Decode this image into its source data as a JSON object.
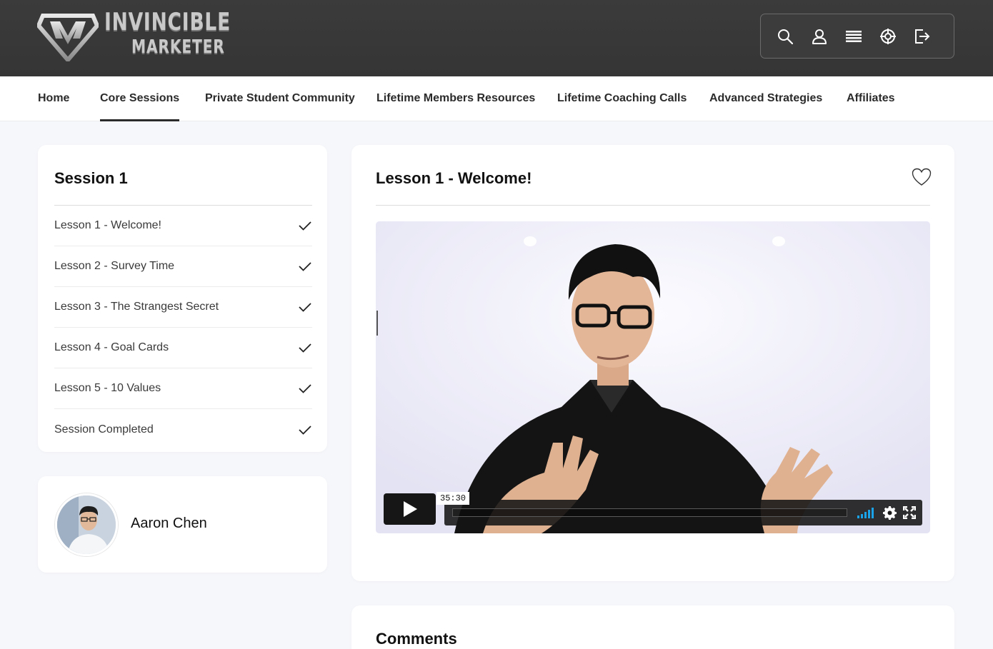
{
  "brand": {
    "line1": "INVINCIBLE",
    "line2": "MARKETER"
  },
  "toolbar": {
    "icons": [
      "search-icon",
      "user-icon",
      "list-icon",
      "support-icon",
      "logout-icon"
    ]
  },
  "nav": {
    "items": [
      {
        "label": "Home"
      },
      {
        "label": "Core Sessions",
        "active": true
      },
      {
        "label": "Private Student Community"
      },
      {
        "label": "Lifetime Members Resources"
      },
      {
        "label": "Lifetime Coaching Calls"
      },
      {
        "label": "Advanced Strategies"
      },
      {
        "label": "Affiliates"
      }
    ]
  },
  "session": {
    "title": "Session 1",
    "lessons": [
      {
        "label": "Lesson 1 - Welcome!",
        "completed": true
      },
      {
        "label": "Lesson 2 - Survey Time",
        "completed": true
      },
      {
        "label": "Lesson 3 - The Strangest Secret",
        "completed": true
      },
      {
        "label": "Lesson 4 - Goal Cards",
        "completed": true
      },
      {
        "label": "Lesson 5 - 10 Values",
        "completed": true
      },
      {
        "label": "Session Completed",
        "completed": true
      }
    ]
  },
  "author": {
    "name": "Aaron Chen"
  },
  "lesson": {
    "title": "Lesson 1 - Welcome!"
  },
  "video": {
    "duration": "35:30",
    "progress": 0
  },
  "comments": {
    "title": "Comments"
  },
  "colors": {
    "header_bg": "#3b3b3b",
    "page_bg": "#f6f7fb",
    "card_bg": "#ffffff",
    "volume_accent": "#1aa3e8"
  }
}
